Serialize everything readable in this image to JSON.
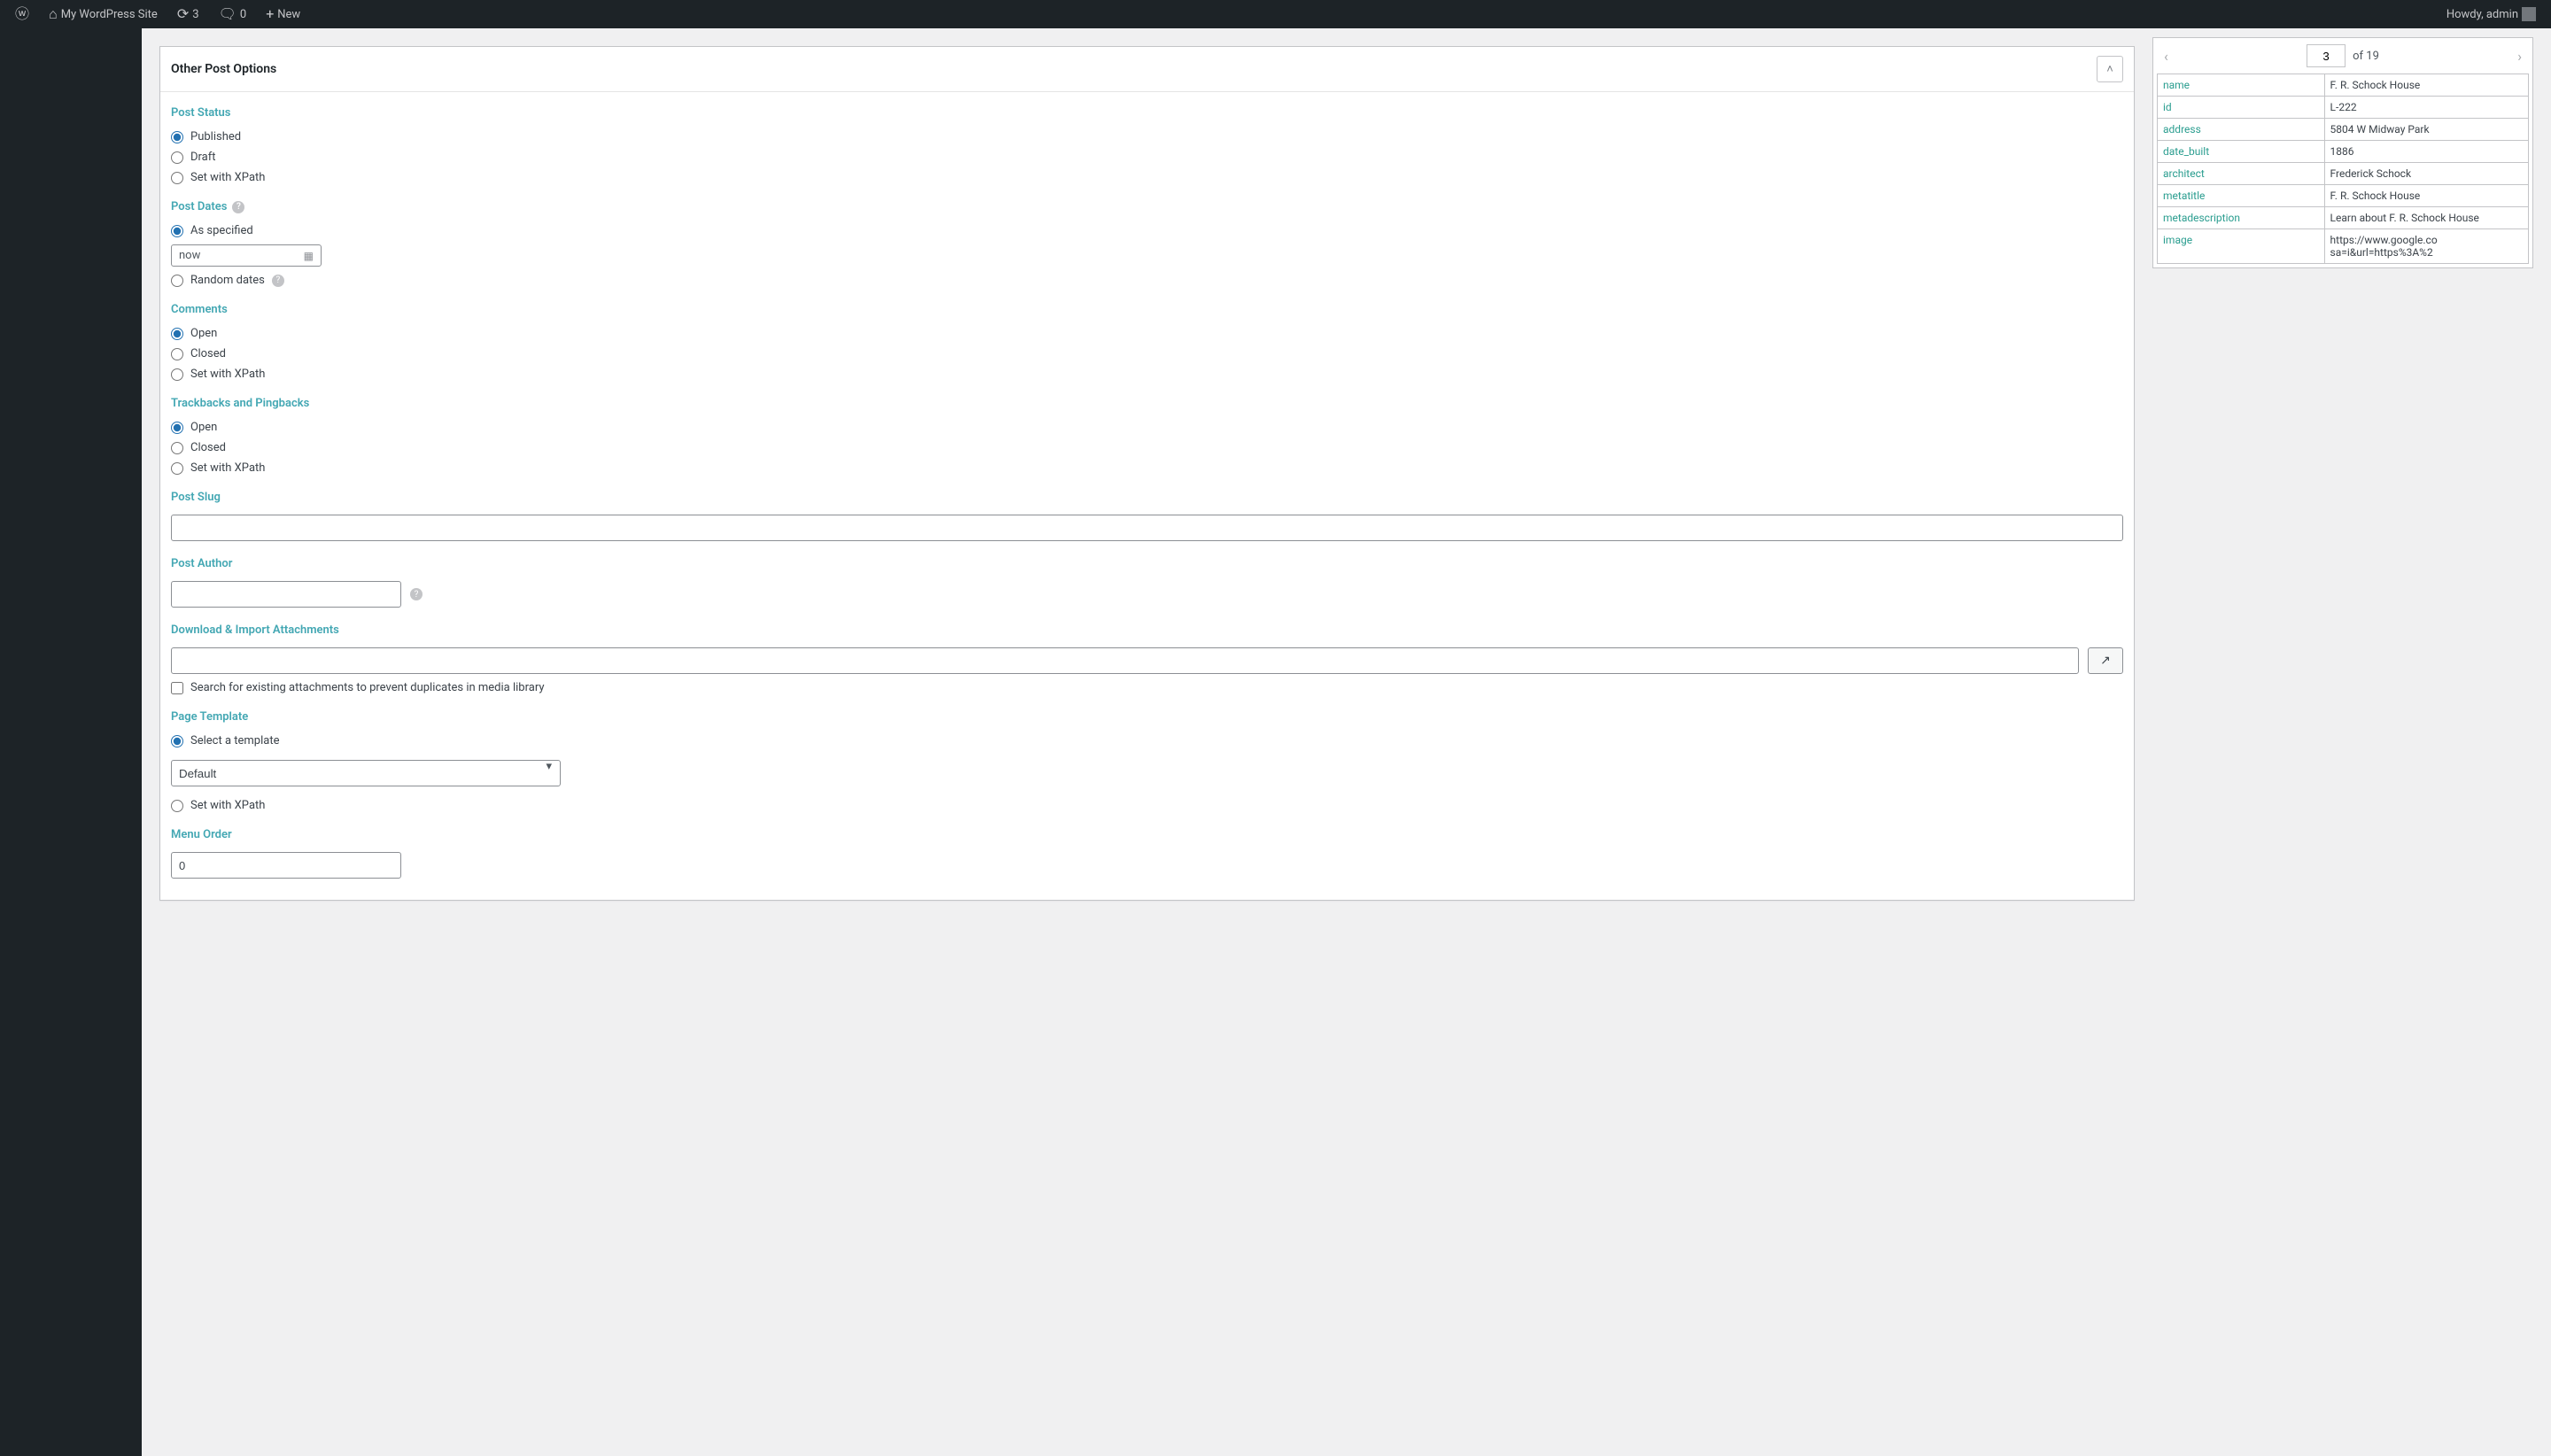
{
  "adminbar": {
    "site_name": "My WordPress Site",
    "updates_count": "3",
    "comments_count": "0",
    "new_label": "New",
    "howdy": "Howdy, admin"
  },
  "panel": {
    "title": "Other Post Options",
    "post_status": {
      "heading": "Post Status",
      "published": "Published",
      "draft": "Draft",
      "set_xpath": "Set with XPath"
    },
    "post_dates": {
      "heading": "Post Dates",
      "as_specified": "As specified",
      "date_value": "now",
      "random_dates": "Random dates"
    },
    "comments": {
      "heading": "Comments",
      "open": "Open",
      "closed": "Closed",
      "set_xpath": "Set with XPath"
    },
    "trackbacks": {
      "heading": "Trackbacks and Pingbacks",
      "open": "Open",
      "closed": "Closed",
      "set_xpath": "Set with XPath"
    },
    "post_slug": {
      "heading": "Post Slug",
      "value": ""
    },
    "post_author": {
      "heading": "Post Author",
      "value": ""
    },
    "attachments": {
      "heading": "Download & Import Attachments",
      "value": "",
      "search_existing": "Search for existing attachments to prevent duplicates in media library"
    },
    "page_template": {
      "heading": "Page Template",
      "select_template": "Select a template",
      "default_option": "Default",
      "set_xpath": "Set with XPath"
    },
    "menu_order": {
      "heading": "Menu Order",
      "value": "0"
    }
  },
  "preview": {
    "current": "3",
    "total": "of 19",
    "rows": [
      {
        "key": "name",
        "val": "F. R. Schock House"
      },
      {
        "key": "id",
        "val": "L-222"
      },
      {
        "key": "address",
        "val": "5804 W Midway Park"
      },
      {
        "key": "date_built",
        "val": "1886"
      },
      {
        "key": "architect",
        "val": "Frederick Schock"
      },
      {
        "key": "metatitle",
        "val": "F. R. Schock House"
      },
      {
        "key": "metadescription",
        "val": "Learn about F. R. Schock House"
      },
      {
        "key": "image",
        "val": "https://www.google.co sa=i&url=https%3A%2"
      }
    ]
  }
}
